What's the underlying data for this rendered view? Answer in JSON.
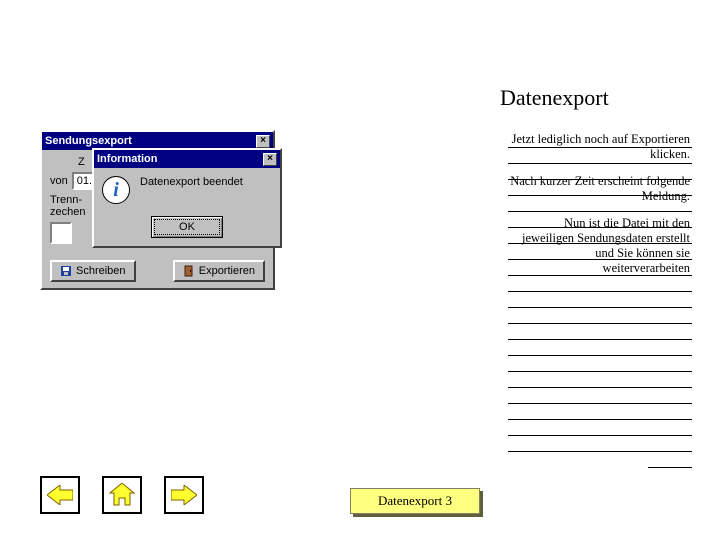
{
  "page_title": "Datenexport",
  "outer_dialog": {
    "title": "Sendungsexport",
    "close_sym": "×",
    "label_z": "Z",
    "label_von": "von",
    "date_value": "01.",
    "trenn_label": "Trenn-\nzechen",
    "btn_schreiben": "Schreiben",
    "btn_exportieren": "Exportieren"
  },
  "inner_dialog": {
    "title": "Information",
    "close_sym": "×",
    "message": "Datenexport beendet",
    "ok_label": "OK"
  },
  "paras": {
    "p1": "Jetzt lediglich noch auf Exportieren klicken.",
    "p2": "Nach kurzer Zeit erscheint folgende Meldung.",
    "p3": "Nun ist die Datei mit den jeweiligen Sendungsdaten erstellt und Sie können sie weiterverarbeiten"
  },
  "slide_label": "Datenexport 3",
  "nav": {
    "prev": "previous",
    "home": "home",
    "next": "next"
  }
}
